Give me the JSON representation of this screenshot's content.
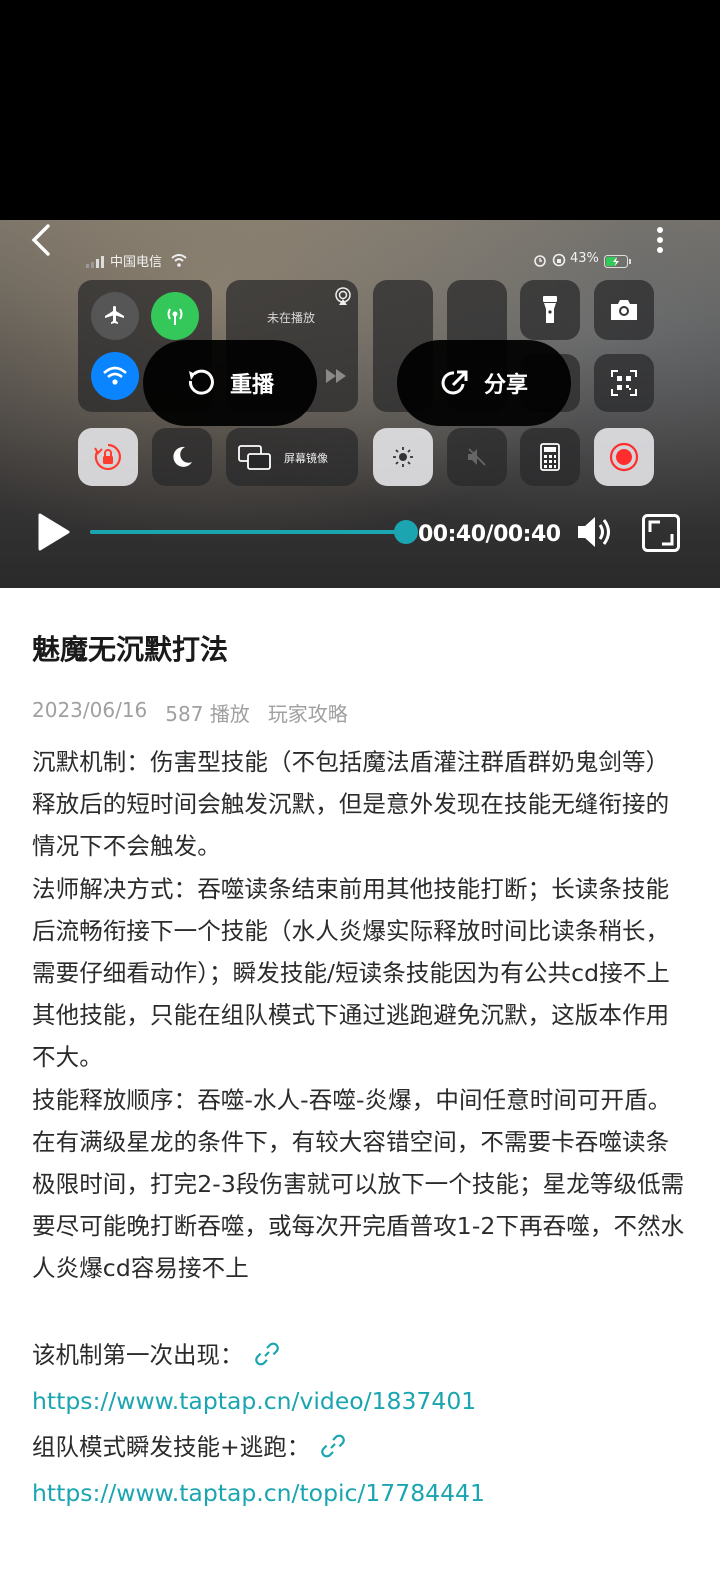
{
  "player": {
    "status_bar": {
      "carrier": "中国电信",
      "battery": "43%"
    },
    "control_center": {
      "now_playing": "未在播放",
      "screen_mirror": "屏幕镜像"
    },
    "replay_label": "重播",
    "share_label": "分享",
    "time": "00:40/00:40",
    "progress": 1.0
  },
  "article": {
    "title": "魅魔无沉默打法",
    "date": "2023/06/16",
    "plays": "587 播放",
    "category": "玩家攻略",
    "paragraphs": [
      "沉默机制：伤害型技能（不包括魔法盾灌注群盾群奶鬼剑等）释放后的短时间会触发沉默，但是意外发现在技能无缝衔接的情况下不会触发。",
      "法师解决方式：吞噬读条结束前用其他技能打断；长读条技能后流畅衔接下一个技能（水人炎爆实际释放时间比读条稍长，需要仔细看动作）；瞬发技能/短读条技能因为有公共cd接不上其他技能，只能在组队模式下通过逃跑避免沉默，这版本作用不大。",
      "技能释放顺序：吞噬-水人-吞噬-炎爆，中间任意时间可开盾。",
      "在有满级星龙的条件下，有较大容错空间，不需要卡吞噬读条极限时间，打完2-3段伤害就可以放下一个技能；星龙等级低需要尽可能晚打断吞噬，或每次开完盾普攻1-2下再吞噬，不然水人炎爆cd容易接不上"
    ],
    "links": [
      {
        "label": "该机制第一次出现：",
        "url": "https://www.taptap.cn/video/1837401"
      },
      {
        "label": "组队模式瞬发技能+逃跑：",
        "url": "https://www.taptap.cn/topic/17784441"
      }
    ]
  },
  "colors": {
    "accent": "#1aa5b0",
    "record": "#ff2d2d",
    "green": "#34c759",
    "blue": "#0a84ff"
  },
  "icons": [
    "back-icon",
    "more-icon",
    "replay-icon",
    "share-icon",
    "play-icon",
    "volume-icon",
    "fullscreen-icon",
    "link-icon"
  ]
}
